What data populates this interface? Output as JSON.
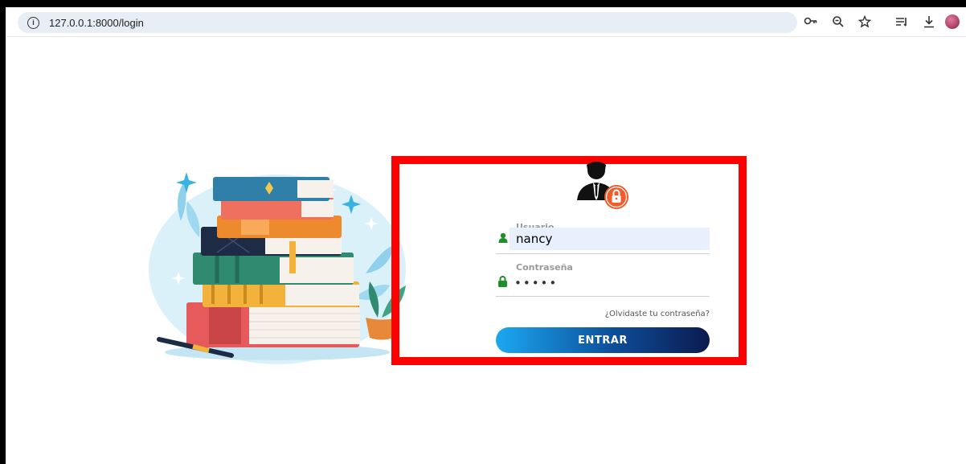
{
  "browser": {
    "url": "127.0.0.1:8000/login",
    "icons": [
      "info-icon",
      "key-icon",
      "zoom-icon",
      "star-icon",
      "reading-list-icon",
      "download-icon",
      "profile-avatar"
    ]
  },
  "login": {
    "username_label": "Usuario",
    "username_value": "nancy",
    "password_label": "Contraseña",
    "password_value": "nancy",
    "forgot_link": "¿Olvidaste tu contraseña?",
    "submit_label": "ENTRAR"
  },
  "colors": {
    "highlight_border": "#ff0000",
    "button_gradient_start": "#1ba8f0",
    "button_gradient_end": "#0b1a4f",
    "input_fill": "#e8f0fe",
    "icon_green": "#1f8f2a",
    "lock_badge": "#f05a28"
  }
}
